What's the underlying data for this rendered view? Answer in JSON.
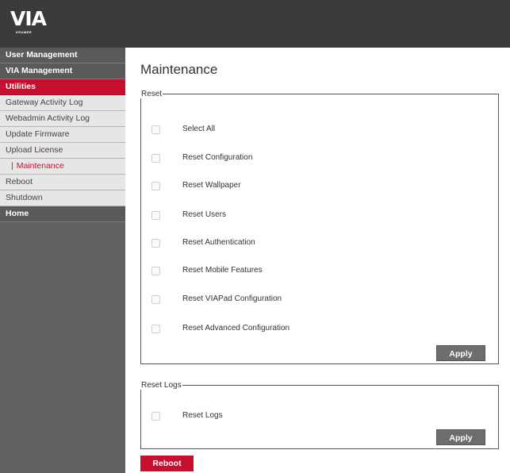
{
  "brand": {
    "logo_text": "VIA",
    "logo_subtext": "KRAMER"
  },
  "sidebar": {
    "items": [
      {
        "label": "User Management",
        "kind": "section"
      },
      {
        "label": "VIA Management",
        "kind": "section"
      },
      {
        "label": "Utilities",
        "kind": "section-active"
      },
      {
        "label": "Gateway Activity Log",
        "kind": "sub"
      },
      {
        "label": "Webadmin Activity Log",
        "kind": "sub"
      },
      {
        "label": "Update Firmware",
        "kind": "sub"
      },
      {
        "label": "Upload License",
        "kind": "sub"
      },
      {
        "label": "Maintenance",
        "kind": "sub-current",
        "marker": "|"
      },
      {
        "label": "Reboot",
        "kind": "sub"
      },
      {
        "label": "Shutdown",
        "kind": "sub"
      },
      {
        "label": "Home",
        "kind": "section"
      }
    ]
  },
  "main": {
    "title": "Maintenance",
    "reset": {
      "legend": "Reset",
      "options": [
        {
          "label": "Select All",
          "checked": false
        },
        {
          "label": "Reset Configuration",
          "checked": false
        },
        {
          "label": "Reset Wallpaper",
          "checked": false
        },
        {
          "label": "Reset Users",
          "checked": false
        },
        {
          "label": "Reset Authentication",
          "checked": false
        },
        {
          "label": "Reset Mobile Features",
          "checked": false
        },
        {
          "label": "Reset VIAPad Configuration",
          "checked": false
        },
        {
          "label": "Reset Advanced Configuration",
          "checked": false
        }
      ],
      "apply_label": "Apply"
    },
    "reset_logs": {
      "legend": "Reset Logs",
      "options": [
        {
          "label": "Reset Logs",
          "checked": false
        }
      ],
      "apply_label": "Apply"
    },
    "reboot_label": "Reboot"
  },
  "colors": {
    "accent": "#c8102e",
    "header_bg": "#3b3b3b",
    "sidebar_bg": "#616161",
    "button_gray": "#6d6d6d"
  }
}
